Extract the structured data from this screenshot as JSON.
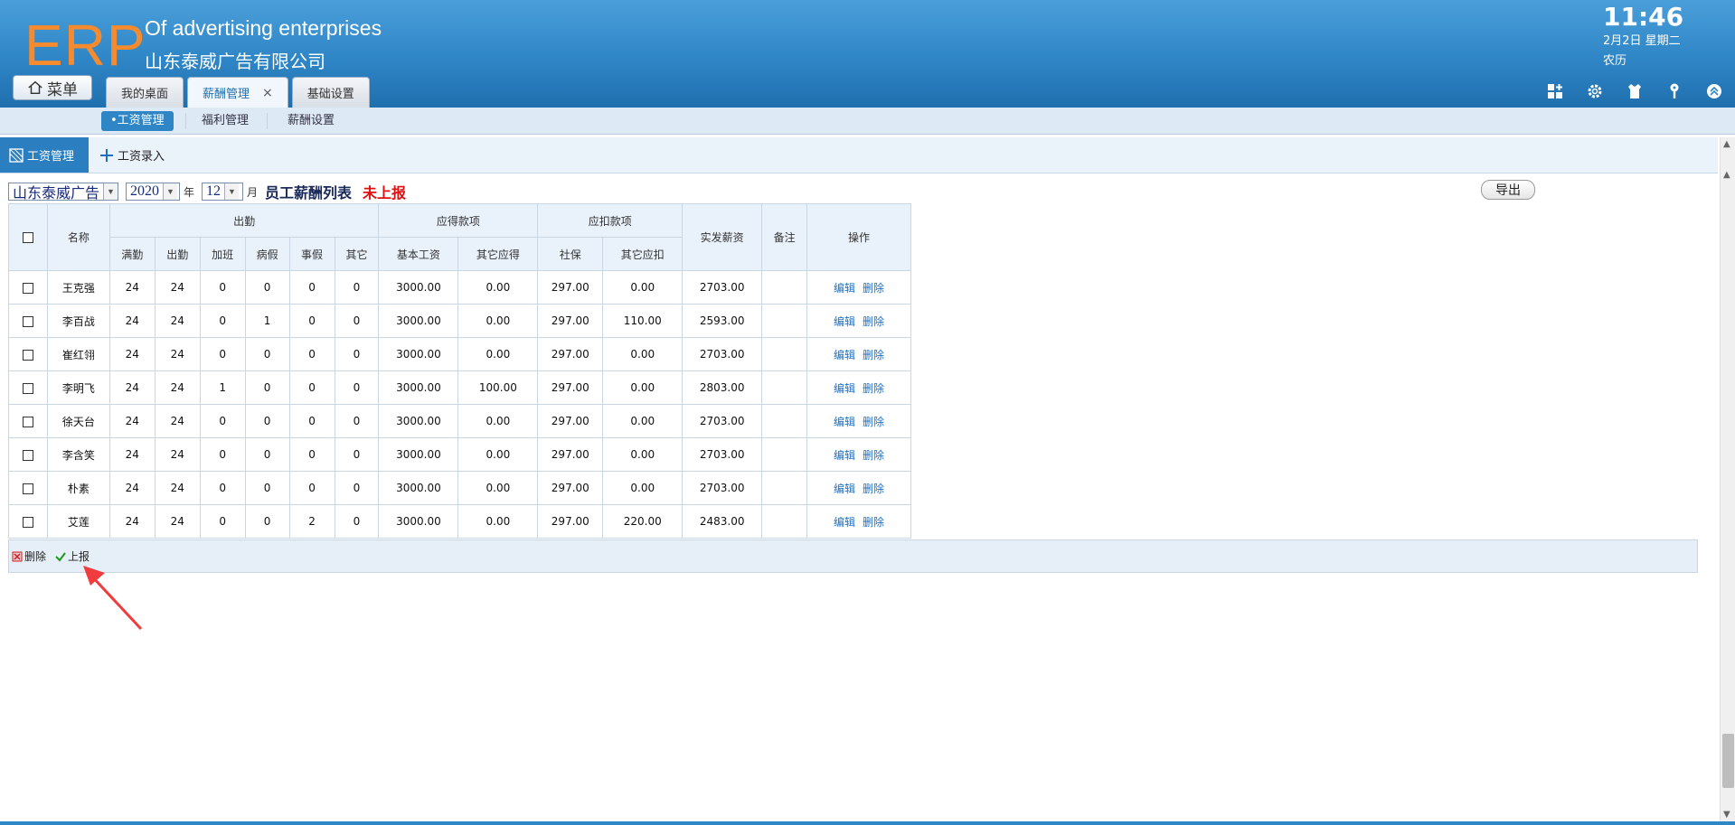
{
  "header": {
    "logo": "ERP",
    "slogan": "Of advertising enterprises",
    "company": "山东泰威广告有限公司",
    "time": "11:46",
    "date": "2月2日 星期二",
    "lunar": "农历",
    "menu_label": "菜单",
    "tabs": [
      {
        "label": "我的桌面"
      },
      {
        "label": "薪酬管理",
        "close": "×"
      },
      {
        "label": "基础设置"
      }
    ],
    "icons": [
      "add-widget-icon",
      "gear-icon",
      "shirt-icon",
      "key-icon",
      "collapse-icon"
    ]
  },
  "submenu": {
    "items": [
      "•工资管理",
      "福利管理",
      "薪酬设置"
    ]
  },
  "module_bar": {
    "active_tab": "工资管理",
    "add_tab": "工资录入"
  },
  "filter": {
    "company": "山东泰威广告",
    "year": "2020",
    "year_unit": "年",
    "month": "12",
    "month_unit": "月",
    "title": "员工薪酬列表",
    "status": "未上报",
    "export_label": "导出"
  },
  "table": {
    "headers": {
      "name": "名称",
      "group_attendance": "出勤",
      "group_income": "应得款项",
      "group_deduct": "应扣款项",
      "net_pay": "实发薪资",
      "remark": "备注",
      "ops": "操作",
      "full_att": "满勤",
      "att": "出勤",
      "overtime": "加班",
      "sick": "病假",
      "personal": "事假",
      "other": "其它",
      "base_salary": "基本工资",
      "other_income": "其它应得",
      "social": "社保",
      "other_deduct": "其它应扣"
    },
    "edit_label": "编辑",
    "delete_label": "删除",
    "rows": [
      [
        "王克强",
        "24",
        "24",
        "0",
        "0",
        "0",
        "0",
        "3000.00",
        "0.00",
        "297.00",
        "0.00",
        "2703.00",
        ""
      ],
      [
        "李百战",
        "24",
        "24",
        "0",
        "1",
        "0",
        "0",
        "3000.00",
        "0.00",
        "297.00",
        "110.00",
        "2593.00",
        ""
      ],
      [
        "崔红翎",
        "24",
        "24",
        "0",
        "0",
        "0",
        "0",
        "3000.00",
        "0.00",
        "297.00",
        "0.00",
        "2703.00",
        ""
      ],
      [
        "李明飞",
        "24",
        "24",
        "1",
        "0",
        "0",
        "0",
        "3000.00",
        "100.00",
        "297.00",
        "0.00",
        "2803.00",
        ""
      ],
      [
        "徐天台",
        "24",
        "24",
        "0",
        "0",
        "0",
        "0",
        "3000.00",
        "0.00",
        "297.00",
        "0.00",
        "2703.00",
        ""
      ],
      [
        "李含笑",
        "24",
        "24",
        "0",
        "0",
        "0",
        "0",
        "3000.00",
        "0.00",
        "297.00",
        "0.00",
        "2703.00",
        ""
      ],
      [
        "朴素",
        "24",
        "24",
        "0",
        "0",
        "0",
        "0",
        "3000.00",
        "0.00",
        "297.00",
        "0.00",
        "2703.00",
        ""
      ],
      [
        "艾莲",
        "24",
        "24",
        "0",
        "0",
        "2",
        "0",
        "3000.00",
        "0.00",
        "297.00",
        "220.00",
        "2483.00",
        ""
      ]
    ]
  },
  "actions": {
    "delete_label": "删除",
    "report_label": "上报"
  },
  "colors": {
    "header_blue": "#2f86c6",
    "logo_orange": "#f58b2e",
    "status_red": "#e01010",
    "link_blue": "#1e6fc0",
    "arrow_red": "#f03c3c"
  }
}
